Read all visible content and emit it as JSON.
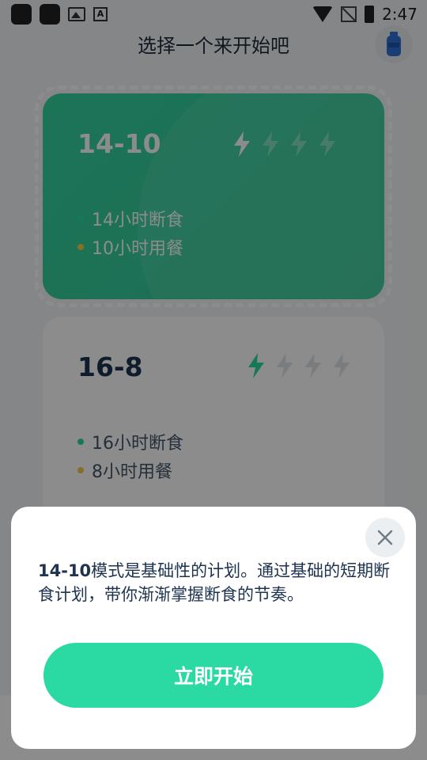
{
  "statusbar": {
    "time": "2:47"
  },
  "header": {
    "title": "选择一个来开始吧"
  },
  "plans": [
    {
      "name": "14-10",
      "fast_label": "14小时断食",
      "eat_label": "10小时用餐",
      "difficulty": 1,
      "max_difficulty": 4
    },
    {
      "name": "16-8",
      "fast_label": "16小时断食",
      "eat_label": "8小时用餐",
      "difficulty": 1,
      "max_difficulty": 4
    }
  ],
  "modal": {
    "plan_bold": "14-10",
    "description": "模式是基础性的计划。通过基础的短期断食计划，带你渐渐掌握断食的节奏。",
    "start_label": "立即开始"
  },
  "colors": {
    "accent": "#2bd9a3",
    "card_green": "#34d39f",
    "fast_dot": "#2bd9a3",
    "eat_dot": "#f5c84b",
    "text_dark": "#1d2a3a"
  },
  "icons": {
    "bolt": "lightning-bolt-icon",
    "close": "close-icon",
    "bottle": "water-bottle-icon"
  }
}
